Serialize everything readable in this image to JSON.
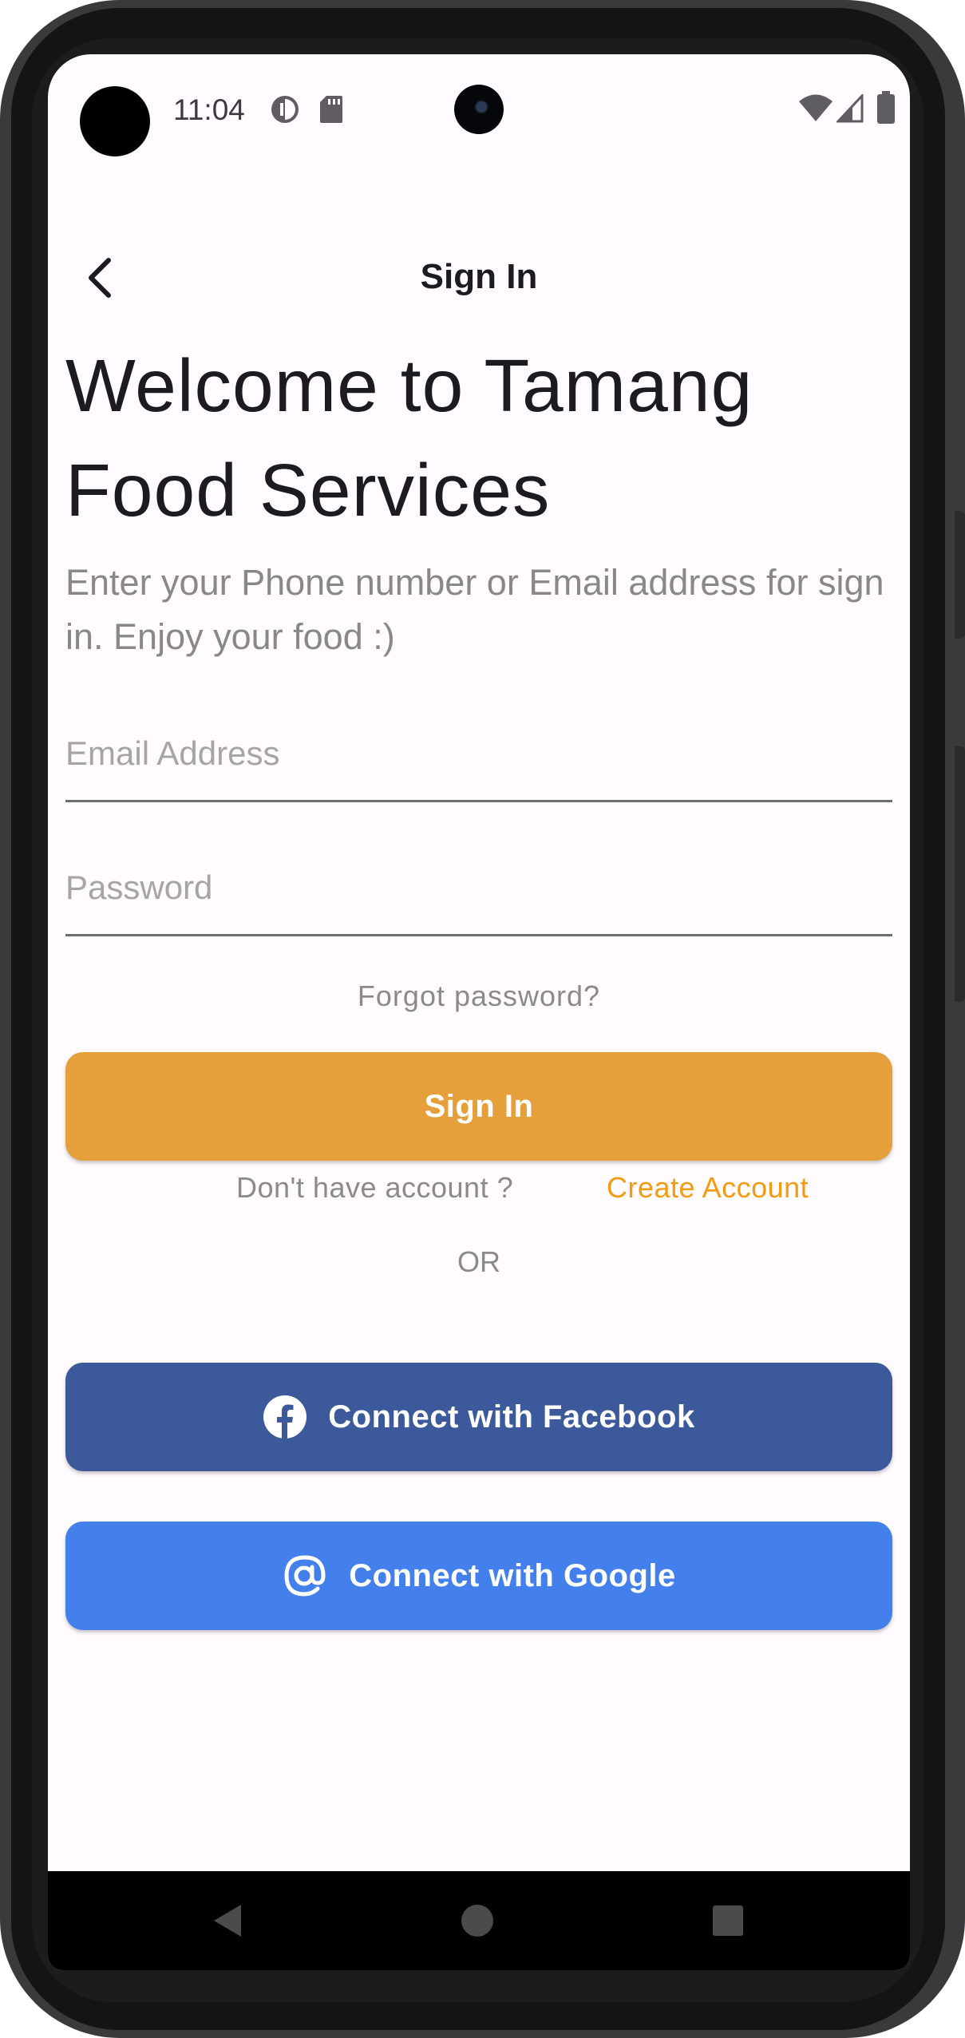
{
  "status_bar": {
    "time": "11:04",
    "icons": [
      "data-saver-icon",
      "sd-card-icon",
      "wifi-icon",
      "cell-signal-icon",
      "battery-icon"
    ]
  },
  "app_bar": {
    "title": "Sign In",
    "back_icon": "arrow-back-icon"
  },
  "welcome": {
    "heading": "Welcome to Tamang Food Services",
    "subtitle": "Enter your Phone number or Email address for sign in. Enjoy your food :)"
  },
  "form": {
    "email": {
      "placeholder": "Email Address",
      "value": ""
    },
    "password": {
      "placeholder": "Password",
      "value": ""
    },
    "forgot_label": "Forgot password?",
    "signin_label": "Sign In"
  },
  "account": {
    "prompt": "Don't have account ?",
    "create_label": "Create Account"
  },
  "divider_label": "OR",
  "social": {
    "facebook_label": "Connect with Facebook",
    "google_label": "Connect with Google"
  },
  "nav": [
    "back-triangle-icon",
    "home-circle-icon",
    "recents-square-icon"
  ],
  "colors": {
    "accent": "#e6a03b",
    "link": "#f39c12",
    "facebook": "#3c5a9b",
    "google": "#4480ec",
    "background": "#fffbfe"
  }
}
